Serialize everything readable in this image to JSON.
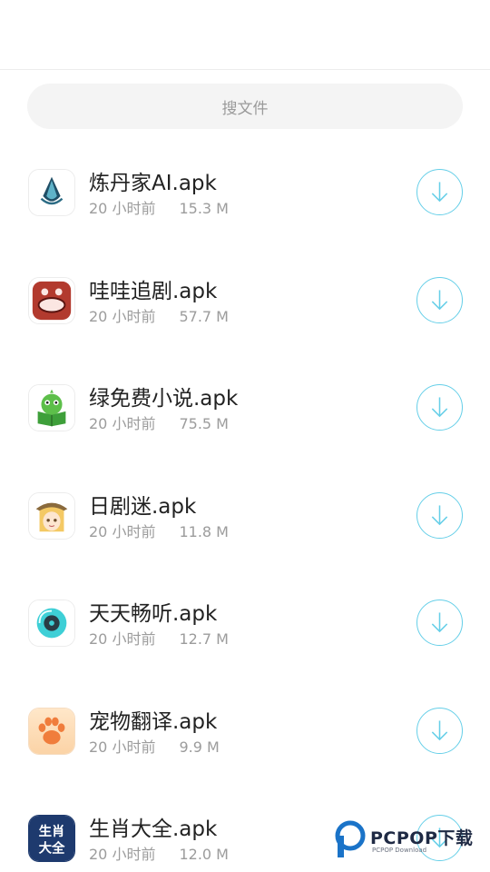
{
  "search": {
    "placeholder": "搜文件"
  },
  "files": [
    {
      "name": "炼丹家AI.apk",
      "time": "20 小时前",
      "size": "15.3 M",
      "icon": "liandanjia-ai-app-icon"
    },
    {
      "name": "哇哇追剧.apk",
      "time": "20 小时前",
      "size": "57.7 M",
      "icon": "wawa-zhuiju-app-icon"
    },
    {
      "name": "绿免费小说.apk",
      "time": "20 小时前",
      "size": "75.5 M",
      "icon": "lv-free-novel-app-icon"
    },
    {
      "name": "日剧迷.apk",
      "time": "20 小时前",
      "size": "11.8 M",
      "icon": "riju-mi-app-icon"
    },
    {
      "name": "天天畅听.apk",
      "time": "20 小时前",
      "size": "12.7 M",
      "icon": "tiantian-changting-app-icon"
    },
    {
      "name": "宠物翻译.apk",
      "time": "20 小时前",
      "size": "9.9 M",
      "icon": "pet-translate-app-icon"
    },
    {
      "name": "生肖大全.apk",
      "time": "20 小时前",
      "size": "12.0 M",
      "icon": "shengxiao-daquan-app-icon",
      "icon_text": [
        "生肖",
        "大全"
      ]
    }
  ],
  "watermark": {
    "brand": "PCPOP下载",
    "sub": "PCPOP Download"
  },
  "colors": {
    "accent": "#66cfe8",
    "text": "#222222",
    "secondary": "#9c9c9c"
  }
}
